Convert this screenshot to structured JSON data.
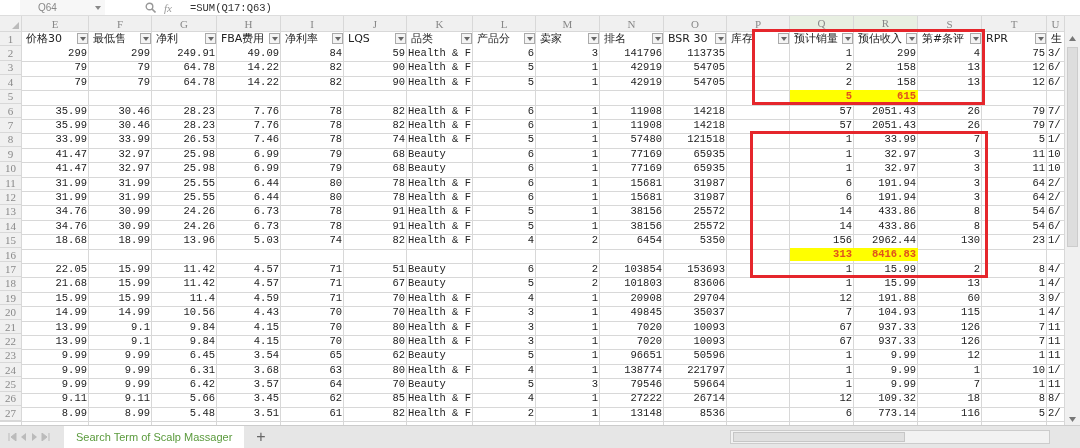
{
  "formula_bar": {
    "name_box": "Q64",
    "fx_label": "fx",
    "formula": "=SUM(Q17:Q63)"
  },
  "header_row_number": "1",
  "columns": [
    {
      "letter": "E",
      "header": "价格30",
      "selected": false
    },
    {
      "letter": "F",
      "header": "最低售",
      "selected": false
    },
    {
      "letter": "G",
      "header": "净利",
      "selected": false
    },
    {
      "letter": "H",
      "header": "FBA费用",
      "selected": false
    },
    {
      "letter": "I",
      "header": "净利率",
      "selected": false
    },
    {
      "letter": "J",
      "header": "LQS",
      "selected": false
    },
    {
      "letter": "K",
      "header": "品类",
      "selected": false
    },
    {
      "letter": "L",
      "header": "产品分",
      "selected": false
    },
    {
      "letter": "M",
      "header": "卖家",
      "selected": false
    },
    {
      "letter": "N",
      "header": "排名",
      "selected": false
    },
    {
      "letter": "O",
      "header": "BSR 30",
      "selected": false
    },
    {
      "letter": "P",
      "header": "库存",
      "selected": false
    },
    {
      "letter": "Q",
      "header": "预计销量",
      "selected": true
    },
    {
      "letter": "R",
      "header": "预估收入",
      "selected": true
    },
    {
      "letter": "S",
      "header": "第#条评",
      "selected": false
    },
    {
      "letter": "T",
      "header": "RPR",
      "selected": false
    },
    {
      "letter": "U",
      "header": "生",
      "selected": false
    }
  ],
  "rows": [
    {
      "number": "2",
      "highlighted": false,
      "cells": [
        "299",
        "299",
        "249.91",
        "49.09",
        "84",
        "59",
        "Health & F",
        "6",
        "3",
        "141796",
        "113735",
        null,
        "1",
        "299",
        "4",
        "75",
        "3/"
      ]
    },
    {
      "number": "3",
      "highlighted": false,
      "cells": [
        "79",
        "79",
        "64.78",
        "14.22",
        "82",
        "90",
        "Health & F",
        "5",
        "1",
        "42919",
        "54705",
        null,
        "2",
        "158",
        "13",
        "12",
        "6/"
      ]
    },
    {
      "number": "4",
      "highlighted": false,
      "cells": [
        "79",
        "79",
        "64.78",
        "14.22",
        "82",
        "90",
        "Health & F",
        "5",
        "1",
        "42919",
        "54705",
        null,
        "2",
        "158",
        "13",
        "12",
        "6/"
      ]
    },
    {
      "number": "5",
      "highlighted": true,
      "cells": [
        null,
        null,
        null,
        null,
        null,
        null,
        null,
        null,
        null,
        null,
        null,
        null,
        "5",
        "615",
        null,
        null,
        null
      ]
    },
    {
      "number": "6",
      "highlighted": false,
      "cells": [
        "35.99",
        "30.46",
        "28.23",
        "7.76",
        "78",
        "82",
        "Health & F",
        "6",
        "1",
        "11908",
        "14218",
        null,
        "57",
        "2051.43",
        "26",
        "79",
        "7/"
      ]
    },
    {
      "number": "7",
      "highlighted": false,
      "cells": [
        "35.99",
        "30.46",
        "28.23",
        "7.76",
        "78",
        "82",
        "Health & F",
        "6",
        "1",
        "11908",
        "14218",
        null,
        "57",
        "2051.43",
        "26",
        "79",
        "7/"
      ]
    },
    {
      "number": "8",
      "highlighted": false,
      "cells": [
        "33.99",
        "33.99",
        "26.53",
        "7.46",
        "78",
        "74",
        "Health & F",
        "5",
        "1",
        "57480",
        "121518",
        null,
        "1",
        "33.99",
        "7",
        "5",
        "1/"
      ]
    },
    {
      "number": "9",
      "highlighted": false,
      "cells": [
        "41.47",
        "32.97",
        "25.98",
        "6.99",
        "79",
        "68",
        "Beauty",
        "6",
        "1",
        "77169",
        "65935",
        null,
        "1",
        "32.97",
        "3",
        "11",
        "10"
      ]
    },
    {
      "number": "10",
      "highlighted": false,
      "cells": [
        "41.47",
        "32.97",
        "25.98",
        "6.99",
        "79",
        "68",
        "Beauty",
        "6",
        "1",
        "77169",
        "65935",
        null,
        "1",
        "32.97",
        "3",
        "11",
        "10"
      ]
    },
    {
      "number": "11",
      "highlighted": false,
      "cells": [
        "31.99",
        "31.99",
        "25.55",
        "6.44",
        "80",
        "78",
        "Health & F",
        "6",
        "1",
        "15681",
        "31987",
        null,
        "6",
        "191.94",
        "3",
        "64",
        "2/"
      ]
    },
    {
      "number": "12",
      "highlighted": false,
      "cells": [
        "31.99",
        "31.99",
        "25.55",
        "6.44",
        "80",
        "78",
        "Health & F",
        "6",
        "1",
        "15681",
        "31987",
        null,
        "6",
        "191.94",
        "3",
        "64",
        "2/"
      ]
    },
    {
      "number": "13",
      "highlighted": false,
      "cells": [
        "34.76",
        "30.99",
        "24.26",
        "6.73",
        "78",
        "91",
        "Health & F",
        "5",
        "1",
        "38156",
        "25572",
        null,
        "14",
        "433.86",
        "8",
        "54",
        "6/"
      ]
    },
    {
      "number": "14",
      "highlighted": false,
      "cells": [
        "34.76",
        "30.99",
        "24.26",
        "6.73",
        "78",
        "91",
        "Health & F",
        "5",
        "1",
        "38156",
        "25572",
        null,
        "14",
        "433.86",
        "8",
        "54",
        "6/"
      ]
    },
    {
      "number": "15",
      "highlighted": false,
      "cells": [
        "18.68",
        "18.99",
        "13.96",
        "5.03",
        "74",
        "82",
        "Health & F",
        "4",
        "2",
        "6454",
        "5350",
        null,
        "156",
        "2962.44",
        "130",
        "23",
        "1/"
      ]
    },
    {
      "number": "16",
      "highlighted": true,
      "cells": [
        null,
        null,
        null,
        null,
        null,
        null,
        null,
        null,
        null,
        null,
        null,
        null,
        "313",
        "8416.83",
        null,
        null,
        null
      ]
    },
    {
      "number": "17",
      "highlighted": false,
      "cells": [
        "22.05",
        "15.99",
        "11.42",
        "4.57",
        "71",
        "51",
        "Beauty",
        "6",
        "2",
        "103854",
        "153693",
        null,
        "1",
        "15.99",
        "2",
        "8",
        "4/"
      ]
    },
    {
      "number": "18",
      "highlighted": false,
      "cells": [
        "21.68",
        "15.99",
        "11.42",
        "4.57",
        "71",
        "67",
        "Beauty",
        "5",
        "2",
        "101803",
        "83606",
        null,
        "1",
        "15.99",
        "13",
        "1",
        "4/"
      ]
    },
    {
      "number": "19",
      "highlighted": false,
      "cells": [
        "15.99",
        "15.99",
        "11.4",
        "4.59",
        "71",
        "70",
        "Health & F",
        "4",
        "1",
        "20908",
        "29704",
        null,
        "12",
        "191.88",
        "60",
        "3",
        "9/"
      ]
    },
    {
      "number": "20",
      "highlighted": false,
      "cells": [
        "14.99",
        "14.99",
        "10.56",
        "4.43",
        "70",
        "70",
        "Health & F",
        "3",
        "1",
        "49845",
        "35037",
        null,
        "7",
        "104.93",
        "115",
        "1",
        "4/"
      ]
    },
    {
      "number": "21",
      "highlighted": false,
      "cells": [
        "13.99",
        "9.1",
        "9.84",
        "4.15",
        "70",
        "80",
        "Health & F",
        "3",
        "1",
        "7020",
        "10093",
        null,
        "67",
        "937.33",
        "126",
        "7",
        "11"
      ]
    },
    {
      "number": "22",
      "highlighted": false,
      "cells": [
        "13.99",
        "9.1",
        "9.84",
        "4.15",
        "70",
        "80",
        "Health & F",
        "3",
        "1",
        "7020",
        "10093",
        null,
        "67",
        "937.33",
        "126",
        "7",
        "11"
      ]
    },
    {
      "number": "23",
      "highlighted": false,
      "cells": [
        "9.99",
        "9.99",
        "6.45",
        "3.54",
        "65",
        "62",
        "Beauty",
        "5",
        "1",
        "96651",
        "50596",
        null,
        "1",
        "9.99",
        "12",
        "1",
        "11"
      ]
    },
    {
      "number": "24",
      "highlighted": false,
      "cells": [
        "9.99",
        "9.99",
        "6.31",
        "3.68",
        "63",
        "80",
        "Health & F",
        "4",
        "1",
        "138774",
        "221797",
        null,
        "1",
        "9.99",
        "1",
        "10",
        "1/"
      ]
    },
    {
      "number": "25",
      "highlighted": false,
      "cells": [
        "9.99",
        "9.99",
        "6.42",
        "3.57",
        "64",
        "70",
        "Beauty",
        "5",
        "3",
        "79546",
        "59664",
        null,
        "1",
        "9.99",
        "7",
        "1",
        "11"
      ]
    },
    {
      "number": "26",
      "highlighted": false,
      "cells": [
        "9.11",
        "9.11",
        "5.66",
        "3.45",
        "62",
        "85",
        "Health & F",
        "4",
        "1",
        "27222",
        "26714",
        null,
        "12",
        "109.32",
        "18",
        "8",
        "8/"
      ]
    },
    {
      "number": "27",
      "highlighted": false,
      "cells": [
        "8.99",
        "8.99",
        "5.48",
        "3.51",
        "61",
        "82",
        "Health & F",
        "2",
        "1",
        "13148",
        "8536",
        null,
        "6",
        "773.14",
        "116",
        "5",
        "2/"
      ]
    }
  ],
  "sheet_tabs": [
    {
      "label": "Search Term of Scalp Massager",
      "selected": true
    }
  ],
  "add_sheet": "+"
}
